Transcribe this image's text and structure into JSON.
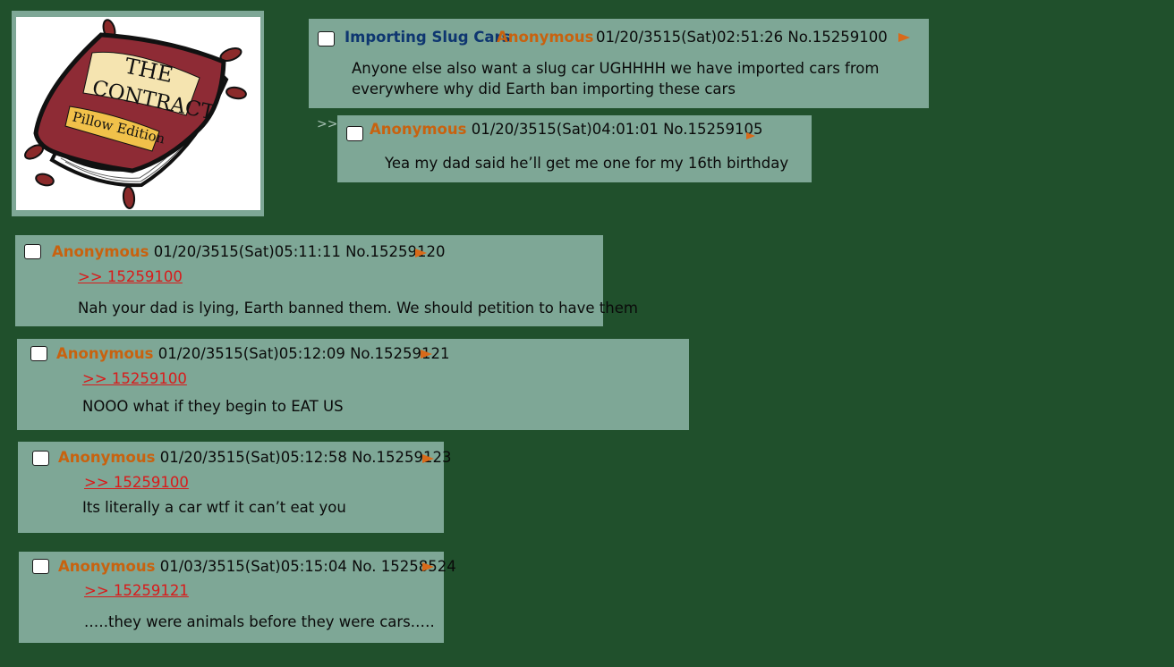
{
  "thumbnail": {
    "line1": "THE",
    "line2": "CONTRACT",
    "edition": "Pillow Edition"
  },
  "op": {
    "subject": "Importing Slug Cars",
    "name": "Anonymous",
    "datetime_no": "01/20/3515(Sat)02:51:26 No.15259100",
    "body_line1": "Anyone else also want a slug car UGHHHH we have imported cars from",
    "body_line2": "everywhere why did Earth ban importing these cars"
  },
  "reply_marker": ">>",
  "replies": [
    {
      "name": "Anonymous",
      "datetime_no": "01/20/3515(Sat)04:01:01 No.15259105",
      "quote": "",
      "body": "Yea my dad said he’ll get me one for my 16th birthday"
    },
    {
      "name": "Anonymous",
      "datetime_no": "01/20/3515(Sat)05:11:11 No.15259120",
      "quote": ">> 15259100",
      "body": "Nah your dad is lying, Earth banned them. We should petition to have them"
    },
    {
      "name": "Anonymous",
      "datetime_no": "01/20/3515(Sat)05:12:09 No.15259121",
      "quote": ">> 15259100",
      "body": "NOOO what if they begin to EAT US"
    },
    {
      "name": "Anonymous",
      "datetime_no": "01/20/3515(Sat)05:12:58 No.15259123",
      "quote": ">> 15259100",
      "body": "Its literally a car wtf it can’t eat you"
    },
    {
      "name": "Anonymous",
      "datetime_no": "01/03/3515(Sat)05:15:04 No. 15258524",
      "quote": ">> 15259121",
      "body": ".….they were animals before they were cars.…."
    }
  ],
  "colors": {
    "background": "#20502c",
    "post": "#7ea796",
    "name": "#c8620f",
    "subject": "#0e3670",
    "quote": "#d81b1b",
    "arrow": "#d86a1a"
  },
  "icons": {
    "checkbox": "checkbox-icon",
    "arrow": "post-menu-arrow-icon"
  }
}
